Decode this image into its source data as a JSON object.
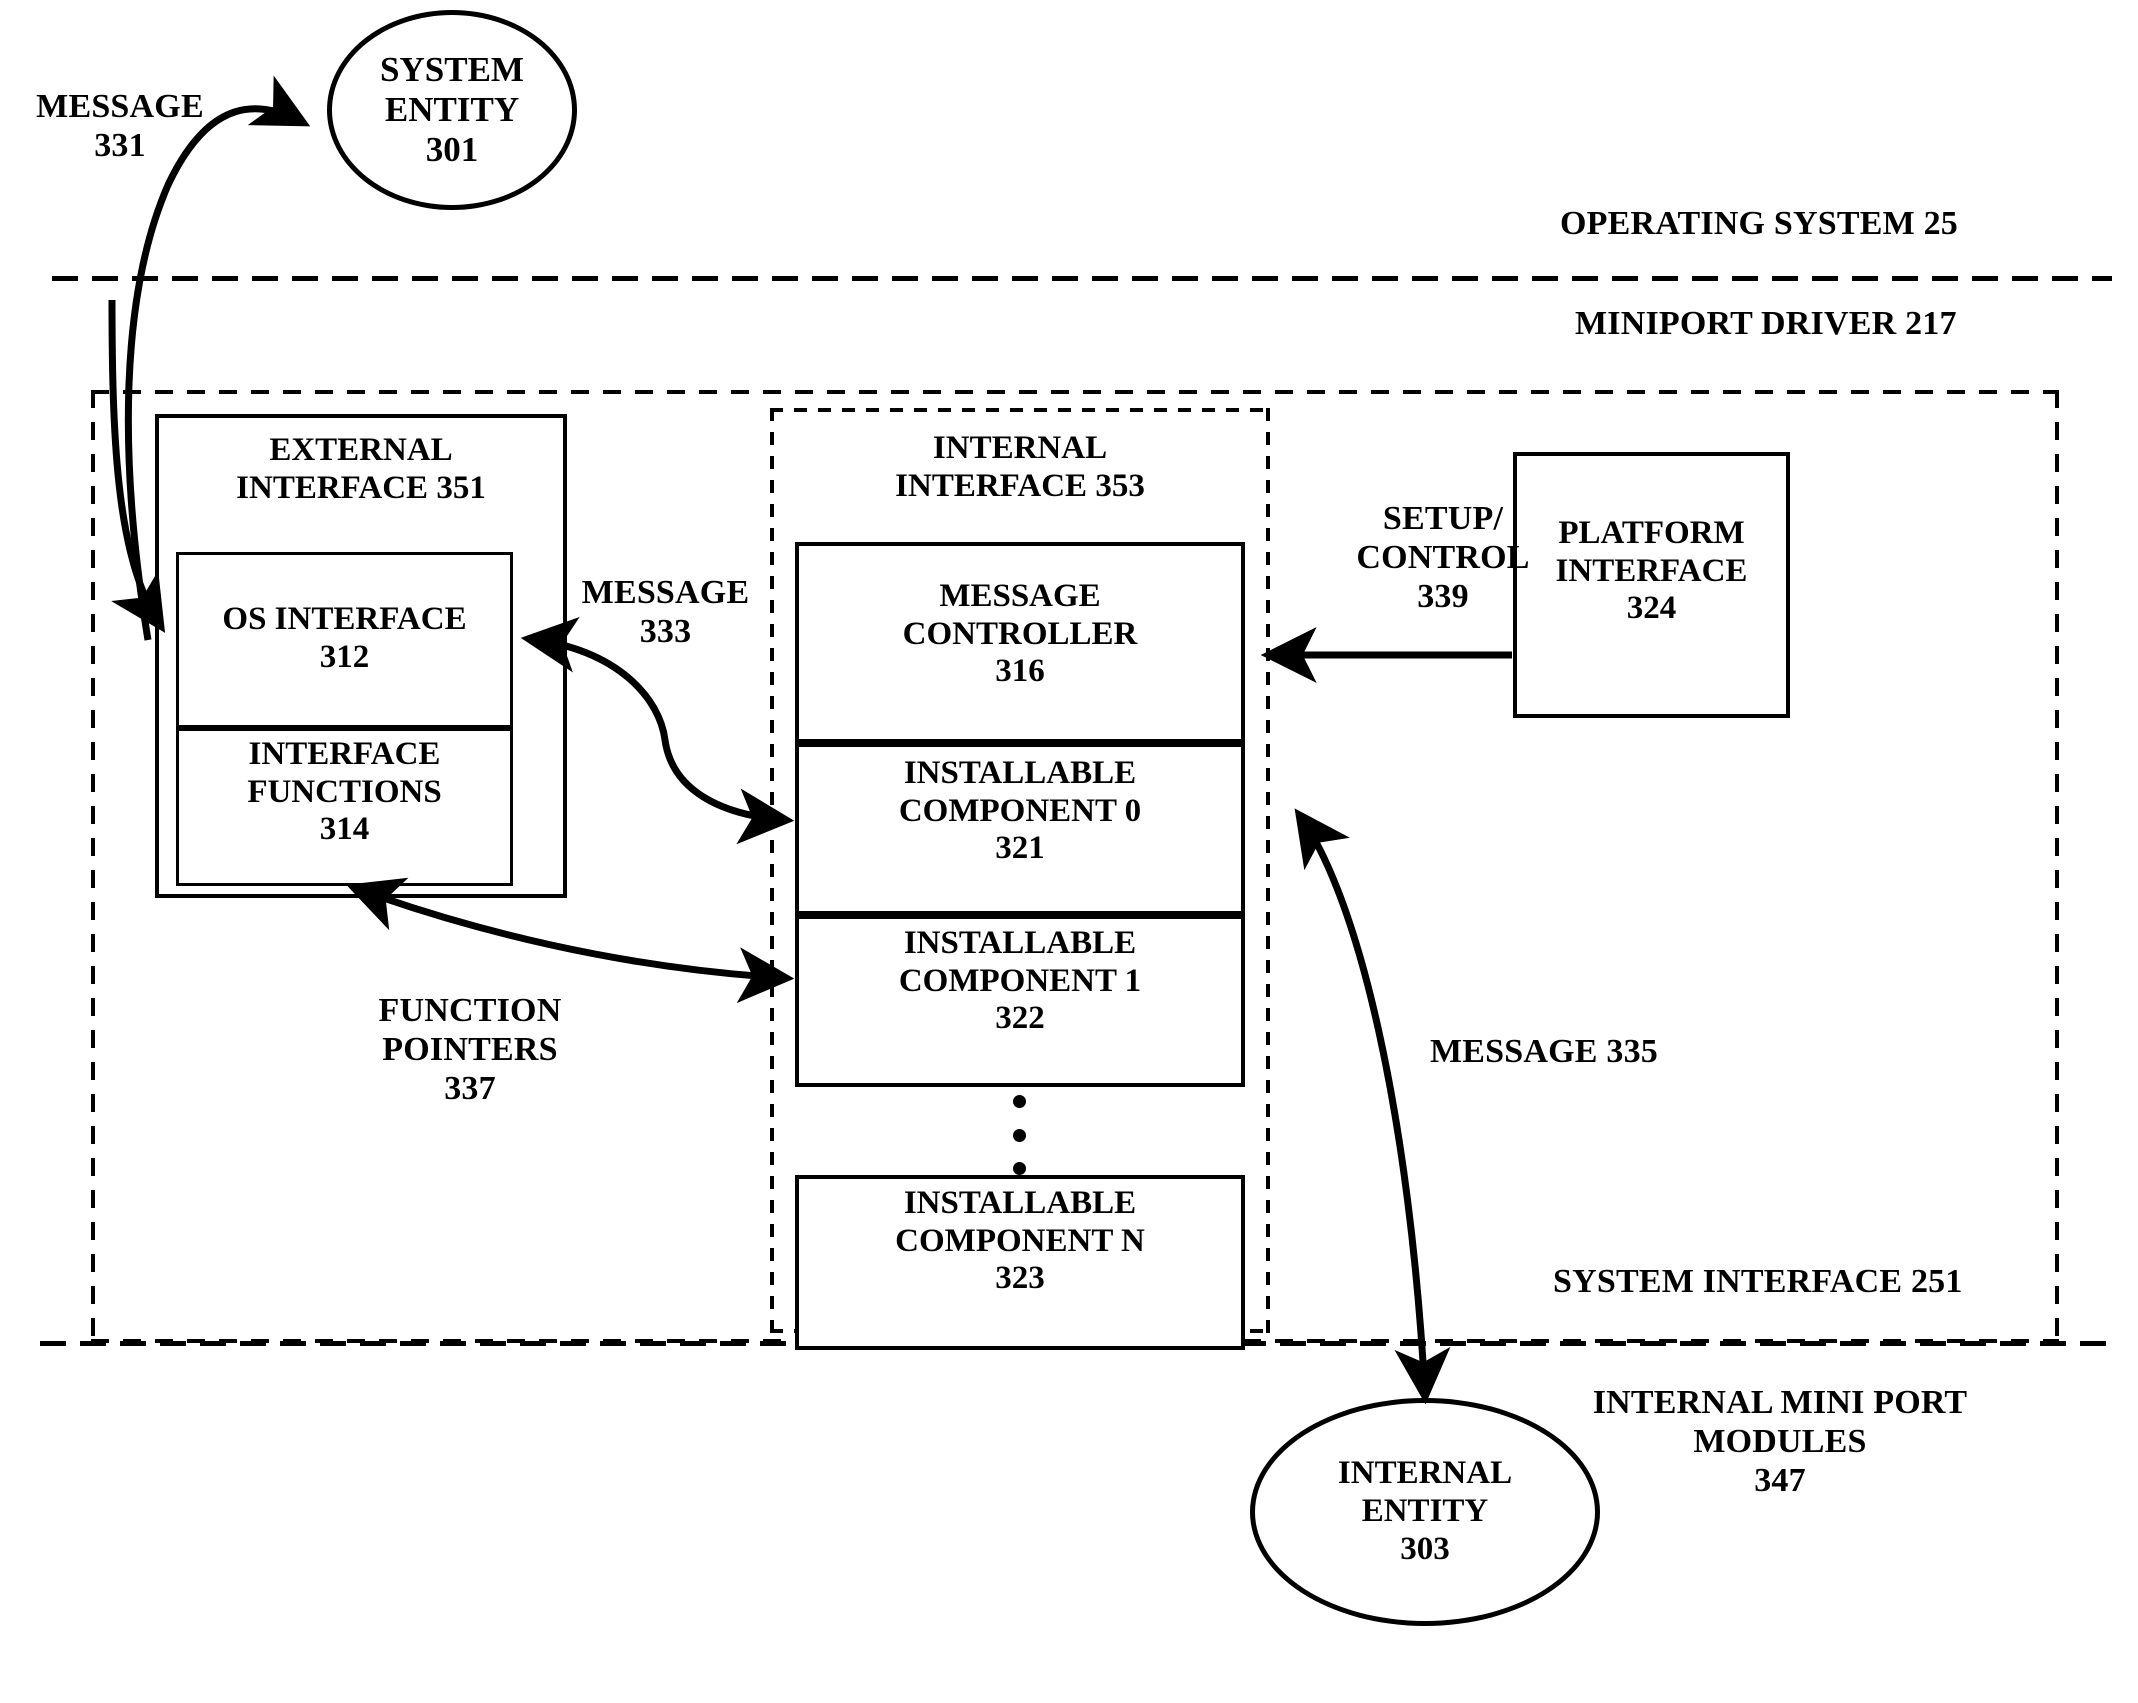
{
  "figure": {
    "type": "patent-block-diagram",
    "layers": {
      "operating_system": "OPERATING SYSTEM 25",
      "miniport_driver": "MINIPORT DRIVER 217",
      "system_interface": "SYSTEM INTERFACE 251",
      "internal_mini_port_modules": "INTERNAL MINI PORT\nMODULES\n347"
    },
    "entities": {
      "system_entity": "SYSTEM\nENTITY\n301",
      "internal_entity": "INTERNAL\nENTITY\n303"
    },
    "external_interface": {
      "title": "EXTERNAL\nINTERFACE 351",
      "blocks": [
        {
          "label": "OS INTERFACE\n312"
        },
        {
          "label": "INTERFACE\nFUNCTIONS\n314"
        }
      ]
    },
    "internal_interface": {
      "title": "INTERNAL\nINTERFACE 353",
      "blocks": [
        {
          "label": "MESSAGE\nCONTROLLER\n316"
        },
        {
          "label": "INSTALLABLE\nCOMPONENT 0\n321"
        },
        {
          "label": "INSTALLABLE\nCOMPONENT 1\n322"
        },
        {
          "label": "INSTALLABLE\nCOMPONENT N\n323"
        }
      ],
      "continuation_marker": "vertical-ellipsis"
    },
    "platform_interface": {
      "label": "PLATFORM\nINTERFACE\n324"
    },
    "arrow_labels": {
      "message_331": "MESSAGE\n331",
      "message_333": "MESSAGE\n333",
      "message_335": "MESSAGE 335",
      "function_pointers_337": "FUNCTION\nPOINTERS\n337",
      "setup_control_339": "SETUP/\nCONTROL\n339"
    }
  }
}
